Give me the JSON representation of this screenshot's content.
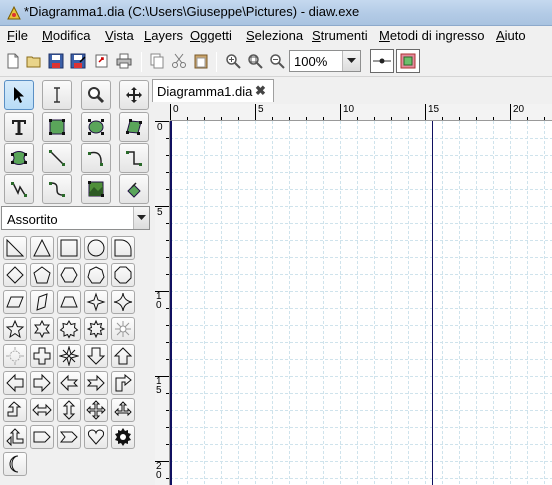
{
  "window": {
    "title": "*Diagramma1.dia (C:\\Users\\Giuseppe\\Pictures) - diaw.exe"
  },
  "menu": [
    {
      "accel": "F",
      "rest": "ile"
    },
    {
      "accel": "M",
      "rest": "odifica"
    },
    {
      "accel": "V",
      "rest": "ista"
    },
    {
      "accel": "L",
      "rest": "ayers"
    },
    {
      "accel": "O",
      "rest": "ggetti"
    },
    {
      "accel": "S",
      "rest": "eleziona"
    },
    {
      "accel": "S",
      "rest": "trumenti"
    },
    {
      "accel": "M",
      "rest": "etodi di ingresso"
    },
    {
      "accel": "A",
      "rest": "iuto"
    }
  ],
  "toolbar": {
    "zoom": "100%",
    "icons": [
      "new-file-icon",
      "open-file-icon",
      "save-icon",
      "save-as-icon",
      "export-icon",
      "print-icon",
      "copy-icon",
      "cut-icon",
      "paste-icon",
      "zoom-in-icon",
      "zoom-fit-icon",
      "zoom-out-icon"
    ]
  },
  "toolbox": {
    "tools": [
      "pointer",
      "text-cursor",
      "magnify",
      "move",
      "text",
      "box",
      "ellipse",
      "polygon",
      "beziergon",
      "line",
      "arc",
      "zigzag-line",
      "polyline",
      "bezier-line",
      "image",
      "outline"
    ],
    "sheet": "Assortito"
  },
  "document": {
    "tab_label": "Diagramma1.dia",
    "close_glyph": "✖"
  },
  "rulers": {
    "horizontal": [
      "0",
      "5",
      "10",
      "15",
      "20"
    ],
    "vertical": [
      "0",
      "5",
      "10",
      "15",
      "20"
    ]
  },
  "colors": {
    "titlebar": "#b9cfe8",
    "grid": "#cfe3ec",
    "page_border": "#101060",
    "selected_tool": "#c5e2f8"
  }
}
